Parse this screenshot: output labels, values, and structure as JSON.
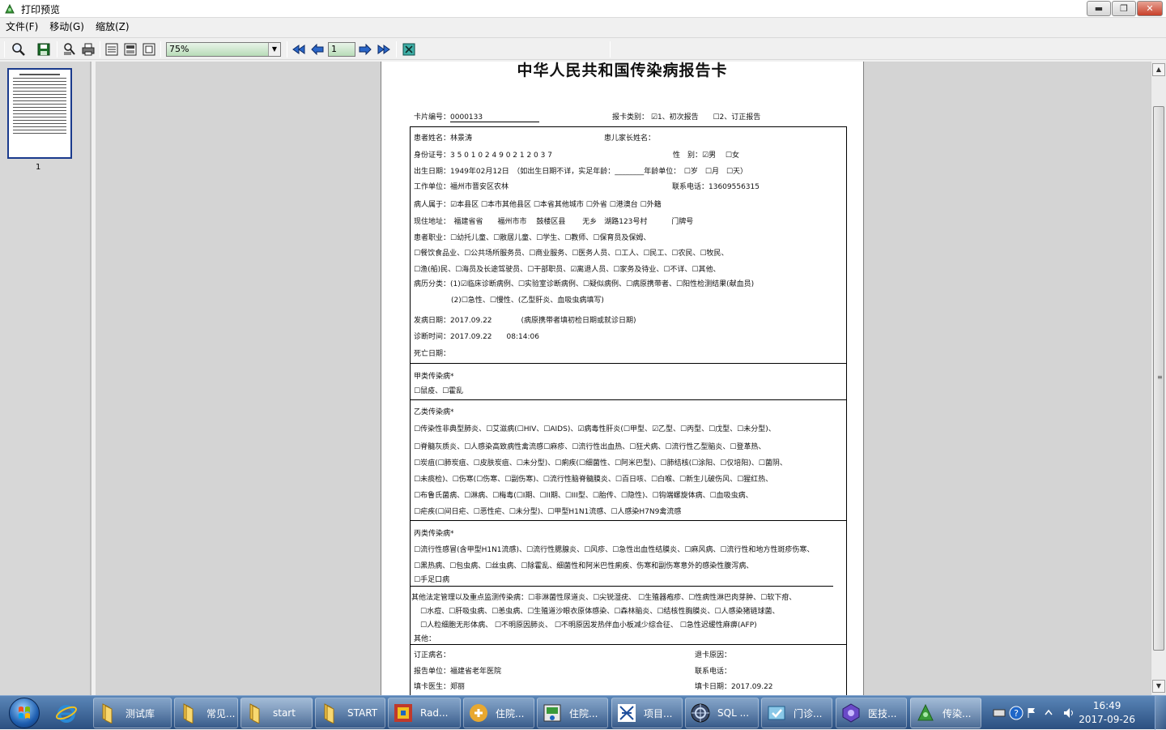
{
  "window": {
    "title": "打印预览",
    "minimize": "▬",
    "maximize": "❐",
    "close": "✕"
  },
  "menu": [
    "文件(F)",
    "移动(G)",
    "缩放(Z)"
  ],
  "toolbar": {
    "zoom": "75%",
    "page": "1"
  },
  "thumbnail": {
    "page_label": "1"
  },
  "document": {
    "title": "中华人民共和国传染病报告卡",
    "card_no_label": "卡片编号：",
    "card_no": "0000133",
    "report_type_label": "报卡类别：",
    "report_first": "☑1、初次报告",
    "report_correct": "☐2、订正报告",
    "patient_name": "患者姓名：林景涛",
    "guardian": "患儿家长姓名：",
    "id_no": "身份证号：3 5 0 1 0 2 4 9 0 2 1 2 0 3 7",
    "sex": "性　别：☑男　 ☐女",
    "birth": "出生日期：1949年02月12日　（如出生日期不详，实足年龄：________年龄单位：　☐岁　☐月　☐天）",
    "work_unit": "工作单位：福州市晋安区农林",
    "phone": "联系电话：13609556315",
    "belongs": "病人属于：☑本县区 ☐本市其他县区 ☐本省其他城市 ☐外省 ☐港澳台 ☐外籍",
    "address": "现住地址：　福建省省　　福州市市　 鼓楼区县　　 无乡　湖路123号村　　　 门牌号",
    "occ1": "患者职业：☐幼托儿童、☐散居儿童、☐学生、☐教师、☐保育员及保姆、",
    "occ2": "☐餐饮食品业、☐公共场所服务员、☐商业服务、☐医务人员、☐工人、☐民工、☐农民、☐牧民、",
    "occ3": "☐渔(船)民、☐海员及长途驾驶员、☐干部职员、☑离退人员、☐家务及待业、☐不详、☐其他、",
    "case1": "病历分类：(1)☑临床诊断病例、☐实验室诊断病例、☐疑似病例、☐病原携带者、☐阳性检测结果(献血员)",
    "case2": "(2)☐急性、☐慢性、(乙型肝炎、血吸虫病填写)",
    "onset": "发病日期：2017.09.22　　　　(病原携带者填初检日期或就诊日期)",
    "diag": "诊断时间：2017.09.22　　08:14:06",
    "death": "死亡日期：",
    "classA_title": "甲类传染病*",
    "classA": "☐鼠疫、☐霍乱",
    "classB_title": "乙类传染病*",
    "classB1": "☐传染性非典型肺炎、☐艾滋病(☐HIV、☐AIDS)、☑病毒性肝炎(☐甲型、☑乙型、☐丙型、☐戊型、☐未分型)、",
    "classB2": "☐脊髓灰质炎、☐人感染高致病性禽流感☐麻疹、☐流行性出血热、☐狂犬病、☐流行性乙型脑炎、☐登革热、",
    "classB3": "☐炭疽(☐肺炭疽、☐皮肤炭疽、☐未分型)、☐痢疾(☐细菌性、☐阿米巴型)、☐肺结核(☐涂阳、☐仅培阳)、☐菌阴、",
    "classB4": "☐未痰检)、☐伤寒(☐伤寒、☐副伤寒)、☐流行性脑脊髓膜炎、☐百日咳、☐白喉、☐新生儿破伤风、☐猩红热、",
    "classB5": "☐布鲁氏菌病、☐淋病、☐梅毒(☐I期、☐II期、☐III型、☐胎传、☐隐性)、☐钩端螺旋体病、☐血吸虫病、",
    "classB6": "☐疟疾(☐间日疟、☐恶性疟、☐未分型)、☐甲型H1N1流感、☐人感染H7N9禽流感",
    "classC_title": "丙类传染病*",
    "classC1": "☐流行性感冒(含甲型H1N1流感)、☐流行性腮腺炎、☐风疹、☐急性出血性结膜炎、☐麻风病、☐流行性和地方性斑疹伤寒、",
    "classC2": "☐黑热病、☐包虫病、☐丝虫病、☐除霍乱、细菌性和阿米巴性痢疾、伤寒和副伤寒意外的感染性腹泻病、",
    "classC3": "☐手足口病",
    "other1": "其他法定管理以及重点监测传染病：☐非淋菌性尿道炎、☐尖锐湿疣、 ☐生殖器疱疹、☐性病性淋巴肉芽肿、☐软下疳、",
    "other2": "☐水痘、☐肝吸虫病、☐恙虫病、☐生殖道沙眼衣原体感染、☐森林脑炎、☐结核性胸膜炎、☐人感染猪链球菌、",
    "other3": "☐人粒细胞无形体病、 ☐不明原因肺炎、 ☐不明原因发热伴血小板减少综合征、 ☐急性迟缓性麻痹(AFP)",
    "other4": "其他：",
    "revised": "订正病名：",
    "return_reason": "退卡原因：",
    "report_unit": "报告单位：福建省老年医院",
    "contact_phone": "联系电话：",
    "doctor": "填卡医生：郑丽",
    "fill_date": "填卡日期：2017.09.22"
  },
  "taskbar": {
    "items": [
      "测试库",
      "常见...",
      "start",
      "START",
      "Rad...",
      "住院...",
      "住院...",
      "项目...",
      "SQL ...",
      "门诊...",
      "医技...",
      "传染..."
    ],
    "time": "16:49",
    "date": "2017-09-26"
  }
}
